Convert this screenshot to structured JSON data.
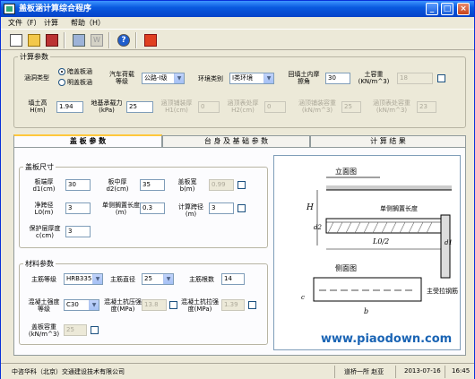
{
  "window": {
    "title": "盖板涵计算综合程序"
  },
  "menu": [
    "文件（F）",
    "计算",
    "帮助（H）"
  ],
  "calc_params": {
    "legend": "计算参数",
    "culvert_type_label": "涵洞类型",
    "culvert_type_options": [
      "暗盖板涵",
      "明盖板涵"
    ],
    "vehicle_load_label": "汽车荷载等级",
    "vehicle_load_value": "公路-I级",
    "env_label": "环境类别",
    "env_value": "I类环境",
    "backfill_angle_label": "回填土内摩擦角",
    "backfill_angle_value": "30",
    "soil_weight_label": "土容重(KN/m^3)",
    "soil_weight_value": "18",
    "fill_height_label": "填土高H(m)",
    "fill_height_value": "1.94",
    "foundation_capacity_label": "地基承载力(kPa)",
    "foundation_capacity_value": "25",
    "top_thickness_label": "涵顶铺装厚H1(cm)",
    "top_thickness_value": "0",
    "top_surface_label": "涵顶表处厚H2(cm)",
    "top_surface_value": "0",
    "paving_weight_label": "涵顶铺装容重(kN/m^3)",
    "paving_weight_value": "25",
    "surface_weight_label": "涵顶表处容重(kN/m^3)",
    "surface_weight_value": "23"
  },
  "tabs": [
    "盖 板 参 数",
    "台 身 及 基 础 参 数",
    "计 算 结 果"
  ],
  "cover_size": {
    "legend": "盖板尺寸",
    "end_thickness_label": "板端厚d1(cm)",
    "end_thickness_value": "30",
    "mid_thickness_label": "板中厚d2(cm)",
    "mid_thickness_value": "35",
    "width_label": "盖板宽b(m)",
    "width_value": "0.99",
    "clear_span_label": "净跨径L0(m)",
    "clear_span_value": "3",
    "rest_length_label": "单侧搁置长度(m)",
    "rest_length_value": "0.3",
    "calc_span_label": "计算跨径(m)",
    "calc_span_value": "3",
    "cover_label": "保护层厚度c(cm)",
    "cover_value": "3"
  },
  "material": {
    "legend": "材料参数",
    "rebar_grade_label": "主筋等级",
    "rebar_grade_value": "HRB335",
    "rebar_dia_label": "主筋直径",
    "rebar_dia_value": "25",
    "rebar_count_label": "主筋根数",
    "rebar_count_value": "14",
    "concrete_grade_label": "混凝土强度等级",
    "concrete_grade_value": "C30",
    "compress_label": "混凝土抗压强度(MPa)",
    "compress_value": "13.8",
    "tensile_label": "混凝土抗拉强度(MPa)",
    "tensile_value": "1.39",
    "cover_weight_label": "盖板容重(kN/m^3)",
    "cover_weight_value": "25"
  },
  "diagram": {
    "elevation": "立面图",
    "side": "侧面图",
    "rest_len": "单侧搁置长度",
    "main_rebar": "主受拉钢筋",
    "H": "H",
    "d2": "d2",
    "d1": "d1",
    "L0": "L0/2",
    "b": "b",
    "c": "c",
    "watermark": "www.piaodown.com"
  },
  "status": {
    "company": "中咨华科（北京）交通建设技术有限公司",
    "user": "道桥一所 赵亚",
    "date": "2013-07-16",
    "time": "16:45"
  }
}
